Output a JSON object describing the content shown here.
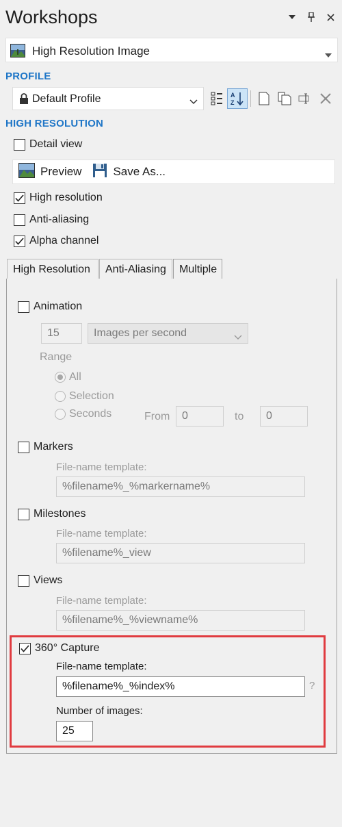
{
  "panel": {
    "title": "Workshops",
    "window_icons": [
      "dropdown-arrow-icon",
      "pin-icon",
      "close-icon"
    ]
  },
  "workshop": {
    "selected": "High Resolution Image",
    "icon": "landscape-image-icon"
  },
  "profile": {
    "section_label": "PROFILE",
    "selected": "Default Profile",
    "toolbar_icons": [
      "categorized-view-icon",
      "sort-alphabetical-icon",
      "new-profile-icon",
      "copy-profile-icon",
      "rename-profile-icon",
      "delete-profile-icon"
    ]
  },
  "high_resolution": {
    "section_label": "HIGH RESOLUTION",
    "detail_view": {
      "label": "Detail view",
      "checked": false
    },
    "preview_label": "Preview",
    "save_as_label": "Save As...",
    "options": [
      {
        "label": "High resolution",
        "checked": true
      },
      {
        "label": "Anti-aliasing",
        "checked": false
      },
      {
        "label": "Alpha channel",
        "checked": true
      }
    ]
  },
  "tabs": [
    {
      "label": "High Resolution",
      "active": false
    },
    {
      "label": "Anti-Aliasing",
      "active": false
    },
    {
      "label": "Multiple",
      "active": true
    }
  ],
  "multiple": {
    "animation": {
      "label": "Animation",
      "checked": false,
      "rate_value": "15",
      "rate_unit": "Images per second",
      "range_label": "Range",
      "range_options": [
        {
          "label": "All",
          "selected": true
        },
        {
          "label": "Selection",
          "selected": false
        },
        {
          "label": "Seconds",
          "selected": false
        }
      ],
      "from_label": "From",
      "from_value": "0",
      "to_label": "to",
      "to_value": "0"
    },
    "markers": {
      "label": "Markers",
      "checked": false,
      "template_label": "File-name template:",
      "template_value": "%filename%_%markername%"
    },
    "milestones": {
      "label": "Milestones",
      "checked": false,
      "template_label": "File-name template:",
      "template_value": "%filename%_view"
    },
    "views": {
      "label": "Views",
      "checked": false,
      "template_label": "File-name template:",
      "template_value": "%filename%_%viewname%"
    },
    "capture360": {
      "label": "360° Capture",
      "checked": true,
      "template_label": "File-name template:",
      "template_value": "%filename%_%index%",
      "help_label": "?",
      "count_label": "Number of images:",
      "count_value": "25"
    }
  },
  "colors": {
    "section_heading": "#1f76c7",
    "highlight_border": "#e03b40",
    "active_toolbar_button": "#cce4f7"
  }
}
